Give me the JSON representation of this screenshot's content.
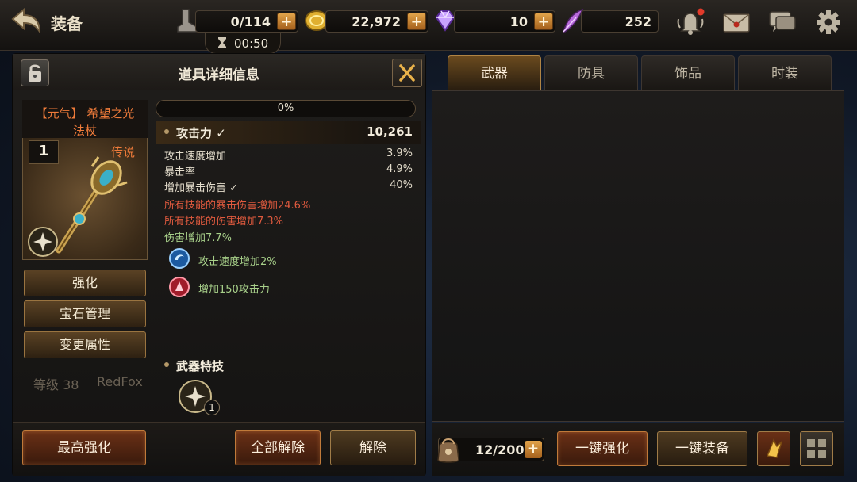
{
  "header": {
    "title": "装备",
    "resources": [
      {
        "name": "stamina",
        "value": "0/114"
      },
      {
        "name": "gold",
        "value": "22,972"
      },
      {
        "name": "diamond",
        "value": "10"
      },
      {
        "name": "feather",
        "value": "252"
      }
    ],
    "timer": "00:50"
  },
  "detail_panel": {
    "title": "道具详细信息",
    "item": {
      "name_line1": "【元气】 希望之光",
      "name_line2": "法杖",
      "level": "1",
      "grade": "传说"
    },
    "progress_text": "0%",
    "main_stat": {
      "label": "攻击力 ✓",
      "value": "10,261"
    },
    "stats": [
      {
        "label": "攻击速度增加",
        "value": "3.9%"
      },
      {
        "label": "暴击率",
        "value": "4.9%"
      },
      {
        "label": "增加暴击伤害 ✓",
        "value": "40%"
      }
    ],
    "special_stats": [
      "所有技能的暴击伤害增加24.6%",
      "所有技能的伤害增加7.3%"
    ],
    "bonus_stat": "伤害增加7.7%",
    "gems": [
      {
        "text": "攻击速度增加2%"
      },
      {
        "text": "增加150攻击力"
      }
    ],
    "skill_section_title": "武器特技",
    "skill_level": "1",
    "side_buttons": [
      "强化",
      "宝石管理",
      "变更属性"
    ],
    "footer_buttons": {
      "max_enhance": "最高强化",
      "unequip_all": "全部解除",
      "unequip": "解除"
    },
    "background_ghost": {
      "level_text": "等级 38",
      "player_name": "RedFox"
    }
  },
  "inventory_panel": {
    "tabs": [
      "武器",
      "防具",
      "饰品",
      "时装"
    ],
    "active_tab": 0,
    "capacity": "12/200",
    "buttons": {
      "auto_enhance": "一键强化",
      "auto_equip": "一键装备"
    }
  },
  "colors": {
    "legend_orange": "#ef7b3a",
    "special_red": "#e05a3e",
    "bonus_green": "#a8d08a",
    "plus_gold": "#e2a44a"
  }
}
